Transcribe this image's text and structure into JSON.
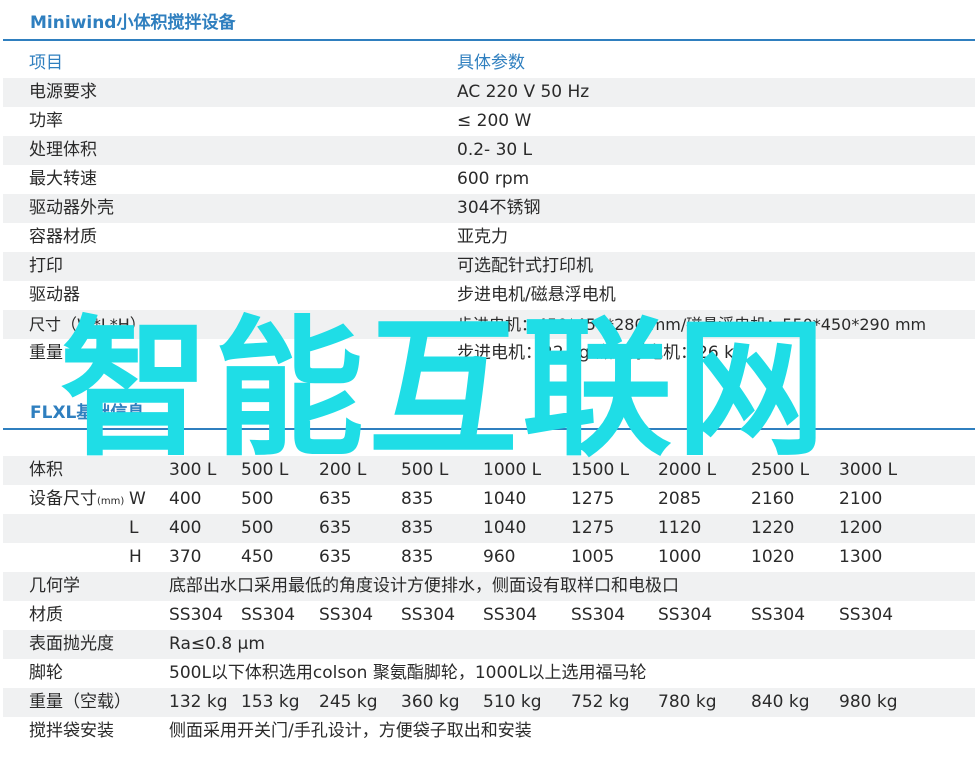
{
  "mini": {
    "title": "Miniwind小体积搅拌设备",
    "header": {
      "item": "项目",
      "spec": "具体参数"
    },
    "rows": [
      {
        "item": "电源要求",
        "spec": "AC 220  V 50 Hz"
      },
      {
        "item": "功率",
        "spec": "≤ 200 W"
      },
      {
        "item": "处理体积",
        "spec": "0.2-  30 L"
      },
      {
        "item": "最大转速",
        "spec": "600  rpm"
      },
      {
        "item": "驱动器外壳",
        "spec": "304不锈钢"
      },
      {
        "item": "容器材质",
        "spec": "亚克力"
      },
      {
        "item": "打印",
        "spec": "可选配针式打印机"
      },
      {
        "item": "驱动器",
        "spec": "步进电机/磁悬浮电机"
      },
      {
        "item": "尺寸（W*L*H）",
        "spec": "步进电机：450*450*280 mm/磁悬浮电机：550*450*290 mm"
      },
      {
        "item": "重量",
        "spec": "步进电机：22 kg 磁悬浮电机：26 kg"
      }
    ]
  },
  "flxl": {
    "title": "FLXL基础信息",
    "volume": {
      "label": "体积",
      "values": [
        "300 L",
        "500 L",
        "200 L",
        "500 L",
        "1000 L",
        "1500 L",
        "2000 L",
        "2500 L",
        "3000 L"
      ]
    },
    "dims": {
      "label": "设备尺寸",
      "unit": "(mm)",
      "rows": [
        {
          "axis": "W",
          "values": [
            "400",
            "500",
            "635",
            "835",
            "1040",
            "1275",
            "2085",
            "2160",
            "2100"
          ]
        },
        {
          "axis": "L",
          "values": [
            "400",
            "500",
            "635",
            "835",
            "1040",
            "1275",
            "1120",
            "1220",
            "1200"
          ]
        },
        {
          "axis": "H",
          "values": [
            "370",
            "450",
            "635",
            "835",
            "960",
            "1005",
            "1000",
            "1020",
            "1300"
          ]
        }
      ]
    },
    "geometry": {
      "label": "几何学",
      "text": "底部出水口采用最低的角度设计方便排水，侧面设有取样口和电极口"
    },
    "material": {
      "label": "材质",
      "values": [
        "SS304",
        "SS304",
        "SS304",
        "SS304",
        "SS304",
        "SS304",
        "SS304",
        "SS304",
        "SS304"
      ]
    },
    "polish": {
      "label": "表面抛光度",
      "text": "Ra≤0.8 µm"
    },
    "casters": {
      "label": "脚轮",
      "text": "500L以下体积选用colson 聚氨酯脚轮，1000L以上选用福马轮"
    },
    "weight": {
      "label": "重量（空载）",
      "values": [
        "132 kg",
        "153 kg",
        "245 kg",
        "360 kg",
        "510 kg",
        "752 kg",
        "780 kg",
        "840 kg",
        "980 kg"
      ]
    },
    "bag": {
      "label": "搅拌袋安装",
      "text": "侧面采用开关门/手孔设计，方便袋子取出和安装"
    }
  },
  "watermark": "智能互联网",
  "colors": {
    "accent": "#2f7fbf",
    "shade": "#f0f1f2",
    "watermark": "#1fdde6"
  }
}
